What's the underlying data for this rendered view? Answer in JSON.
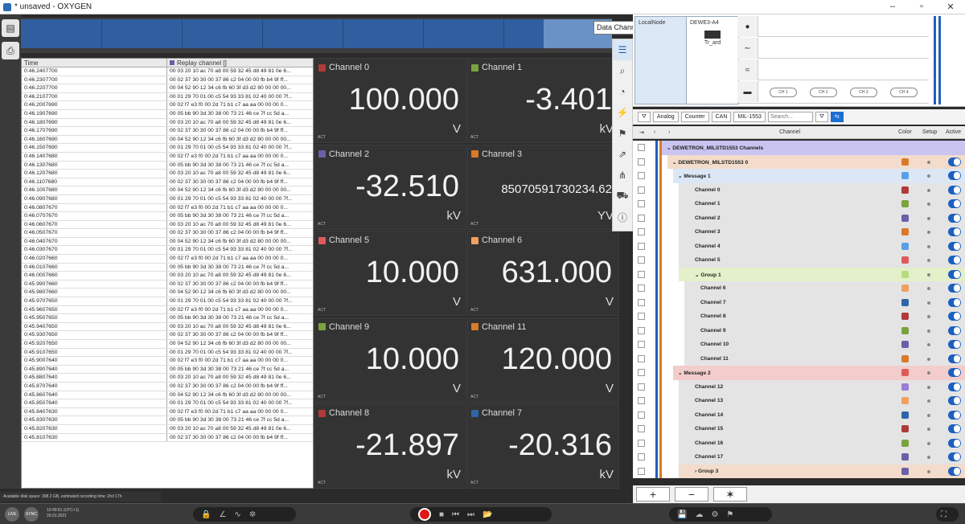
{
  "window": {
    "title": "* unsaved - OXYGEN",
    "minimize": "–",
    "maximize": "▫",
    "close": "✕"
  },
  "tooltip": "Data Channels",
  "log": {
    "col_time": "Time",
    "col_channel": "Replay channel []",
    "rows": [
      [
        "0:46.2407700",
        "00 03 20 10 ac 70 a8 00 59 32 45 d8 49 81 0e 6..."
      ],
      [
        "0:46.2307700",
        "00 02 37 30 30 00 37 86 c2 04 00 00 fb b4 9f ff..."
      ],
      [
        "0:46.2207700",
        "00 04 52 90 12 34 c6 fb 60 3f d3 d2 80 00 00 00..."
      ],
      [
        "0:46.2107700",
        "00 01 29 70 01 00 c5 54 93 33 81 02 40 00 00 7f..."
      ],
      [
        "0:46.2007690",
        "00 02 f7 e3 f0 00 2d 71 b1 c7 aa aa 00 00 00 0..."
      ],
      [
        "0:46.1907690",
        "00 05 bb 90 3d 30 38 00 73 21 46 ce 7f cc 5d a..."
      ],
      [
        "0:46.1807690",
        "00 03 20 10 ac 70 a8 00 59 32 45 d8 49 81 0e 6..."
      ],
      [
        "0:46.1707690",
        "00 02 37 30 30 00 37 86 c2 04 00 00 fb b4 9f ff..."
      ],
      [
        "0:46.1607690",
        "00 04 52 90 12 34 c6 fb 60 3f d3 d2 80 00 00 00..."
      ],
      [
        "0:46.1507690",
        "00 01 29 70 01 00 c5 54 93 33 81 02 40 00 00 7f..."
      ],
      [
        "0:46.1407680",
        "00 02 f7 e3 f0 00 2d 71 b1 c7 aa aa 00 00 00 0..."
      ],
      [
        "0:46.1307680",
        "00 05 bb 90 3d 30 38 00 73 21 46 ce 7f cc 5d a..."
      ],
      [
        "0:46.1207680",
        "00 03 20 10 ac 70 a8 00 59 32 45 d8 49 81 0e 6..."
      ],
      [
        "0:46.1107680",
        "00 02 37 30 30 00 37 86 c2 04 00 00 fb b4 9f ff..."
      ],
      [
        "0:46.1007680",
        "00 04 52 90 12 34 c6 fb 60 3f d3 d2 80 00 00 00..."
      ],
      [
        "0:46.0907680",
        "00 01 29 70 01 00 c5 54 93 33 81 02 40 00 00 7f..."
      ],
      [
        "0:46.0807670",
        "00 02 f7 e3 f0 00 2d 71 b1 c7 aa aa 00 00 00 0..."
      ],
      [
        "0:46.0707670",
        "00 05 bb 90 3d 30 38 00 73 21 46 ce 7f cc 5d a..."
      ],
      [
        "0:46.0607670",
        "00 03 20 10 ac 70 a8 00 59 32 45 d8 49 81 0e 6..."
      ],
      [
        "0:46.0507670",
        "00 02 37 30 30 00 37 86 c2 04 00 00 fb b4 9f ff..."
      ],
      [
        "0:46.0407670",
        "00 04 52 90 12 34 c6 fb 60 3f d3 d2 80 00 00 00..."
      ],
      [
        "0:46.0307670",
        "00 01 29 70 01 00 c5 54 93 33 81 02 40 00 00 7f..."
      ],
      [
        "0:46.0207660",
        "00 02 f7 e3 f0 00 2d 71 b1 c7 aa aa 00 00 00 0..."
      ],
      [
        "0:46.0107660",
        "00 05 bb 90 3d 30 38 00 73 21 46 ce 7f cc 5d a..."
      ],
      [
        "0:46.0007660",
        "00 03 20 10 ac 70 a8 00 59 32 45 d8 49 81 0e 6..."
      ],
      [
        "0:45.9907660",
        "00 02 37 30 30 00 37 86 c2 04 00 00 fb b4 9f ff..."
      ],
      [
        "0:45.9807660",
        "00 04 52 90 12 34 c6 fb 60 3f d3 d2 80 00 00 00..."
      ],
      [
        "0:45.9707650",
        "00 01 29 70 01 00 c5 54 93 33 81 02 40 00 00 7f..."
      ],
      [
        "0:45.9607650",
        "00 02 f7 e3 f0 00 2d 71 b1 c7 aa aa 00 00 00 0..."
      ],
      [
        "0:45.9507650",
        "00 05 bb 90 3d 30 38 00 73 21 46 ce 7f cc 5d a..."
      ],
      [
        "0:45.9407650",
        "00 03 20 10 ac 70 a8 00 59 32 45 d8 49 81 0e 6..."
      ],
      [
        "0:45.9307650",
        "00 02 37 30 30 00 37 86 c2 04 00 00 fb b4 9f ff..."
      ],
      [
        "0:45.9207650",
        "00 04 52 90 12 34 c6 fb 60 3f d3 d2 80 00 00 00..."
      ],
      [
        "0:45.9107650",
        "00 01 29 70 01 00 c5 54 93 33 81 02 40 00 00 7f..."
      ],
      [
        "0:45.9007640",
        "00 02 f7 e3 f0 00 2d 71 b1 c7 aa aa 00 00 00 0..."
      ],
      [
        "0:45.8907640",
        "00 05 bb 90 3d 30 38 00 73 21 46 ce 7f cc 5d a..."
      ],
      [
        "0:45.8807640",
        "00 03 20 10 ac 70 a8 00 59 32 45 d8 49 81 0e 6..."
      ],
      [
        "0:45.8707640",
        "00 02 37 30 30 00 37 86 c2 04 00 00 fb b4 9f ff..."
      ],
      [
        "0:45.8607640",
        "00 04 52 90 12 34 c6 fb 60 3f d3 d2 80 00 00 00..."
      ],
      [
        "0:45.8507640",
        "00 01 29 70 01 00 c5 54 93 33 81 02 40 00 00 7f..."
      ],
      [
        "0:45.8407630",
        "00 02 f7 e3 f0 00 2d 71 b1 c7 aa aa 00 00 00 0..."
      ],
      [
        "0:45.8307630",
        "00 05 bb 90 3d 30 38 00 73 21 46 ce 7f cc 5d a..."
      ],
      [
        "0:45.8207630",
        "00 03 20 10 ac 70 a8 00 59 32 45 d8 49 81 0e 6..."
      ],
      [
        "0:45.8107630",
        "00 02 37 30 30 00 37 86 c2 04 00 00 fb b4 9f ff..."
      ]
    ]
  },
  "meters": [
    {
      "name": "Channel 0",
      "value": "100.000",
      "unit": "V",
      "color": "#b03a3a"
    },
    {
      "name": "Channel 1",
      "value": "-3.401",
      "unit": "kV",
      "color": "#7aa33e"
    },
    {
      "name": "Channel 2",
      "value": "-32.510",
      "unit": "kV",
      "color": "#6b5fa8"
    },
    {
      "name": "Channel 3",
      "value": "85070591730234.62",
      "unit": "YV",
      "color": "#d97a2b"
    },
    {
      "name": "Channel 5",
      "value": "10.000",
      "unit": "V",
      "color": "#e05a5a"
    },
    {
      "name": "Channel 6",
      "value": "631.000",
      "unit": "V",
      "color": "#f0a060"
    },
    {
      "name": "Channel 9",
      "value": "10.000",
      "unit": "V",
      "color": "#7aa33e"
    },
    {
      "name": "Channel 11",
      "value": "120.000",
      "unit": "V",
      "color": "#d97a2b"
    },
    {
      "name": "Channel 8",
      "value": "-21.897",
      "unit": "kV",
      "color": "#b03a3a"
    },
    {
      "name": "Channel 7",
      "value": "-20.316",
      "unit": "kV",
      "color": "#2e64a8"
    }
  ],
  "meter_act": "ACT",
  "hardware": {
    "node_label": "LocalNode",
    "device_label": "DEWE3-A4",
    "device_sub": "Tr_ard",
    "connectors": [
      "CH 1",
      "CH 2",
      "CH 3",
      "CH 4"
    ]
  },
  "channel_toolbar": {
    "analog": "Analog",
    "counter": "Counter",
    "can": "CAN",
    "mil": "MIL-1553",
    "search_placeholder": "Search..."
  },
  "channel_header": {
    "channel": "Channel",
    "color": "Color",
    "setup": "Setup",
    "active": "Active"
  },
  "tree": [
    {
      "label": "DEWETRON_MILSTD1553 Channels",
      "level": 0,
      "band": "#c9c4f0",
      "swatch": ""
    },
    {
      "label": "DEWETRON_MILSTD1553 0",
      "level": 1,
      "band": "#f3dccb",
      "swatch": "#d97a2b"
    },
    {
      "label": "Message 1",
      "level": 2,
      "band": "#dbe7f5",
      "swatch": "#5a9ee6"
    },
    {
      "label": "Channel 0",
      "level": 3,
      "band": "#e4e4e4",
      "swatch": "#b03a3a"
    },
    {
      "label": "Channel 1",
      "level": 3,
      "band": "#e4e4e4",
      "swatch": "#7aa33e"
    },
    {
      "label": "Channel 2",
      "level": 3,
      "band": "#e4e4e4",
      "swatch": "#6b5fa8"
    },
    {
      "label": "Channel 3",
      "level": 3,
      "band": "#e4e4e4",
      "swatch": "#d97a2b"
    },
    {
      "label": "Channel 4",
      "level": 3,
      "band": "#e4e4e4",
      "swatch": "#5a9ee6"
    },
    {
      "label": "Channel 5",
      "level": 3,
      "band": "#e4e4e4",
      "swatch": "#e05a5a"
    },
    {
      "label": "Group 1",
      "level": 3,
      "band": "#e3f0c9",
      "swatch": "#b9dc7a"
    },
    {
      "label": "Channel 6",
      "level": 4,
      "band": "#e4e4e4",
      "swatch": "#f0a060"
    },
    {
      "label": "Channel 7",
      "level": 4,
      "band": "#e4e4e4",
      "swatch": "#2e64a8"
    },
    {
      "label": "Channel 8",
      "level": 4,
      "band": "#e4e4e4",
      "swatch": "#b03a3a"
    },
    {
      "label": "Channel 9",
      "level": 4,
      "band": "#e4e4e4",
      "swatch": "#7aa33e"
    },
    {
      "label": "Channel 10",
      "level": 4,
      "band": "#e4e4e4",
      "swatch": "#6b5fa8"
    },
    {
      "label": "Channel 11",
      "level": 4,
      "band": "#e4e4e4",
      "swatch": "#d97a2b"
    },
    {
      "label": "Message 2",
      "level": 2,
      "band": "#f3cccc",
      "swatch": "#e05a5a"
    },
    {
      "label": "Channel 12",
      "level": 3,
      "band": "#e4e4e4",
      "swatch": "#9c7cd6"
    },
    {
      "label": "Channel 13",
      "level": 3,
      "band": "#e4e4e4",
      "swatch": "#f0a060"
    },
    {
      "label": "Channel 14",
      "level": 3,
      "band": "#e4e4e4",
      "swatch": "#2e64a8"
    },
    {
      "label": "Channel 15",
      "level": 3,
      "band": "#e4e4e4",
      "swatch": "#b03a3a"
    },
    {
      "label": "Channel 16",
      "level": 3,
      "band": "#e4e4e4",
      "swatch": "#7aa33e"
    },
    {
      "label": "Channel 17",
      "level": 3,
      "band": "#e4e4e4",
      "swatch": "#6b5fa8"
    },
    {
      "label": "Group 3",
      "level": 3,
      "band": "#f3dccb",
      "swatch": "#6b5fa8"
    }
  ],
  "status": {
    "disk": "Available disk space: 308.2 GB, estimated recording time: 2hd 17h",
    "clock_time": "10:49:51 (UTC+1)",
    "clock_date": "29.01.2021",
    "live": "LIVE",
    "sync": "SYNC"
  }
}
